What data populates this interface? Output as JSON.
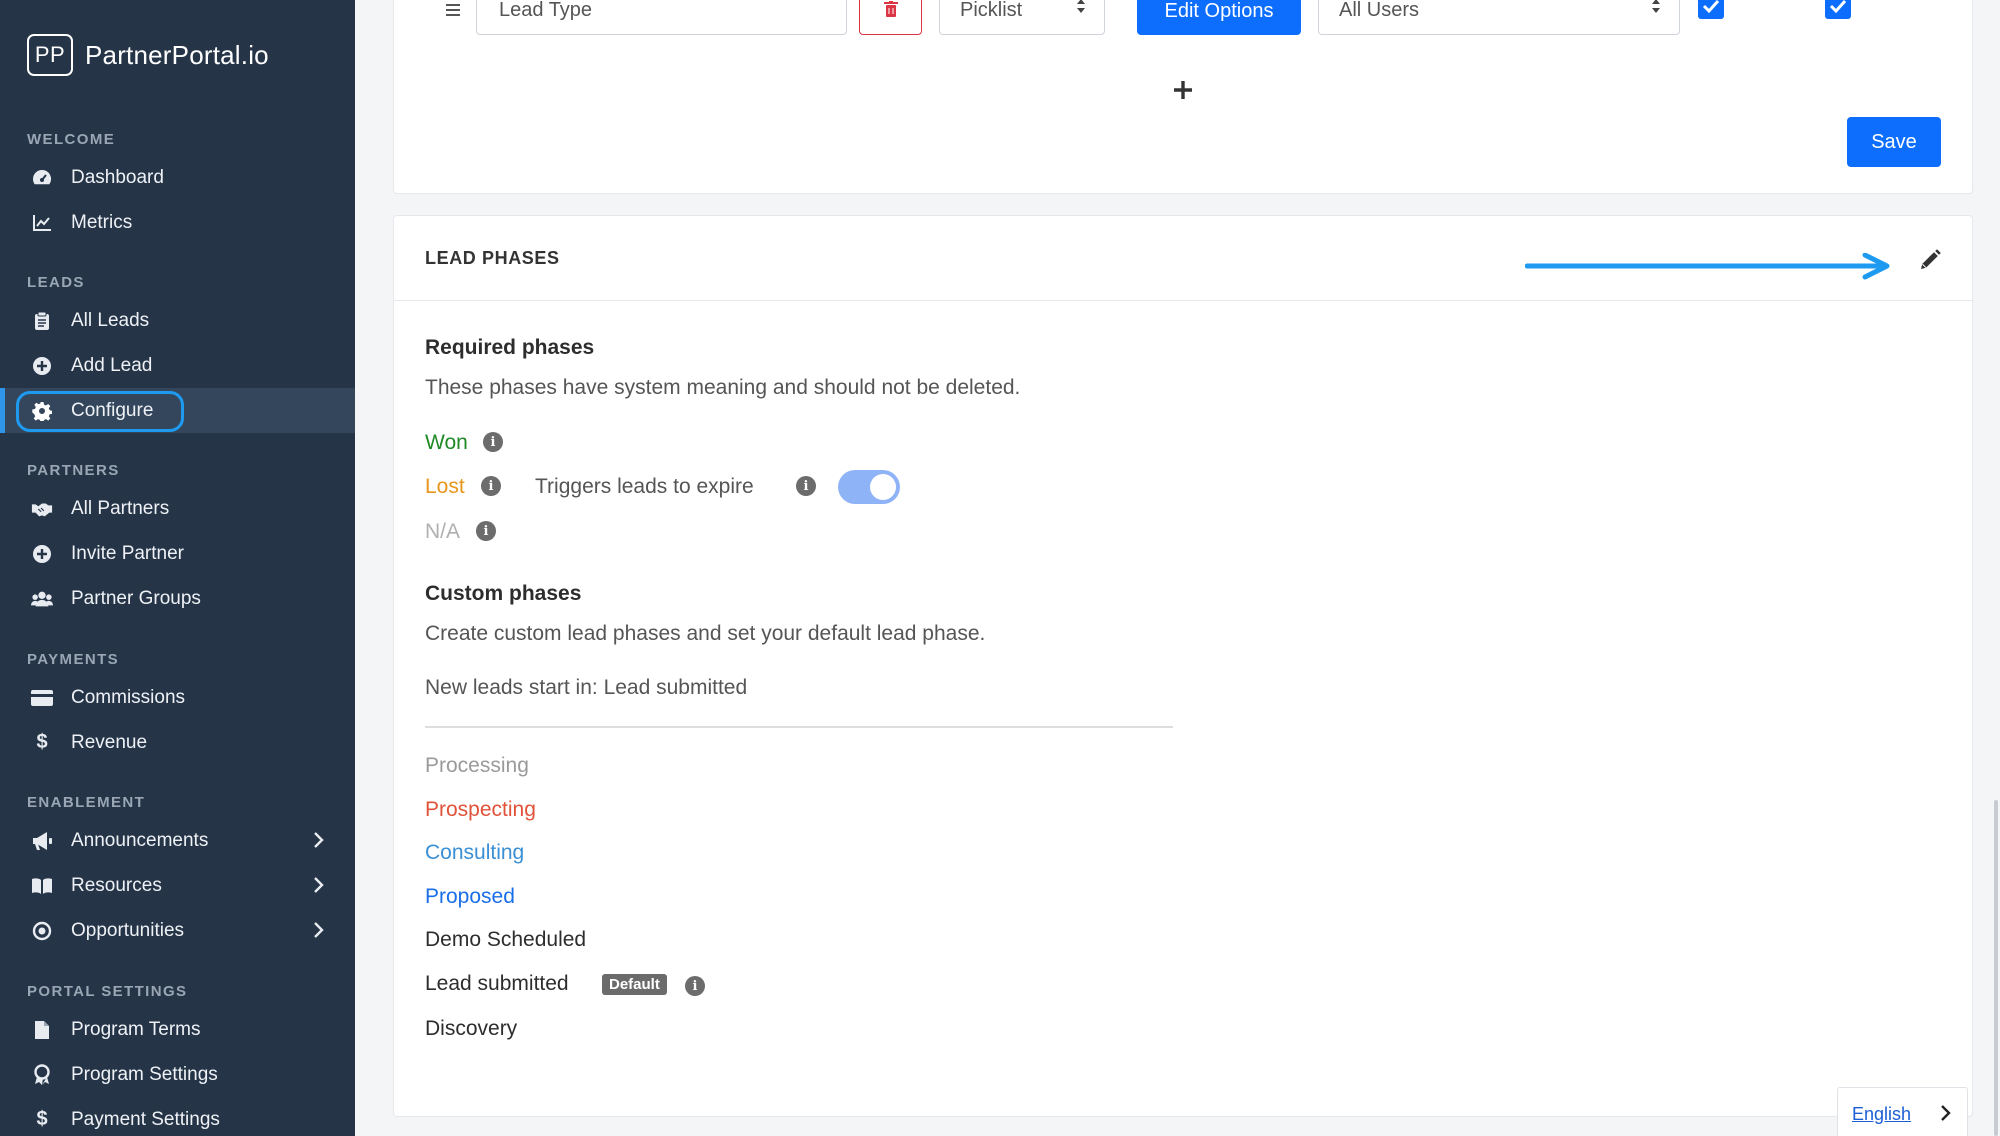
{
  "brand": {
    "logo_text": "PP",
    "name": "PartnerPortal.io"
  },
  "sidebar": {
    "sections": {
      "welcome": "WELCOME",
      "leads": "LEADS",
      "partners": "PARTNERS",
      "payments": "PAYMENTS",
      "enablement": "ENABLEMENT",
      "portal_settings": "PORTAL SETTINGS"
    },
    "items": {
      "dashboard": "Dashboard",
      "metrics": "Metrics",
      "all_leads": "All Leads",
      "add_lead": "Add Lead",
      "configure": "Configure",
      "all_partners": "All Partners",
      "invite_partner": "Invite Partner",
      "partner_groups": "Partner Groups",
      "commissions": "Commissions",
      "revenue": "Revenue",
      "announcements": "Announcements",
      "resources": "Resources",
      "opportunities": "Opportunities",
      "program_terms": "Program Terms",
      "program_settings": "Program Settings",
      "payment_settings": "Payment Settings"
    },
    "active_item": "configure",
    "accent_color": "#2f95e8"
  },
  "field_row": {
    "name_value": "Lead Type",
    "type_value": "Picklist",
    "edit_options_label": "Edit Options",
    "visibility_value": "All Users",
    "checkbox_1_checked": true,
    "checkbox_2_checked": true
  },
  "toolbar": {
    "save_label": "Save"
  },
  "lead_phases": {
    "title": "LEAD PHASES",
    "required": {
      "heading": "Required phases",
      "description": "These phases have system meaning and should not be deleted.",
      "won": "Won",
      "lost": "Lost",
      "na": "N/A",
      "expire_label": "Triggers leads to expire",
      "expire_enabled": true
    },
    "custom": {
      "heading": "Custom phases",
      "description": "Create custom lead phases and set your default lead phase.",
      "default_start": "New leads start in: Lead submitted",
      "phases": [
        {
          "label": "Processing",
          "color": "#9a9a9a"
        },
        {
          "label": "Prospecting",
          "color": "#e0533a"
        },
        {
          "label": "Consulting",
          "color": "#3b8fd4"
        },
        {
          "label": "Proposed",
          "color": "#1a6ee8"
        },
        {
          "label": "Demo Scheduled",
          "color": "#2d2d2d"
        },
        {
          "label": "Lead submitted",
          "color": "#2d2d2d"
        },
        {
          "label": "Discovery",
          "color": "#2d2d2d"
        }
      ],
      "default_badge": "Default"
    },
    "colors": {
      "won": "#1f8a26",
      "lost": "#e8951b",
      "na": "#b0b0b0"
    }
  },
  "language": {
    "label": "English"
  },
  "icons": {
    "handle": "drag-handle-icon",
    "delete": "trash-icon",
    "add": "plus-icon",
    "edit": "pencil-icon",
    "info": "info-icon"
  }
}
